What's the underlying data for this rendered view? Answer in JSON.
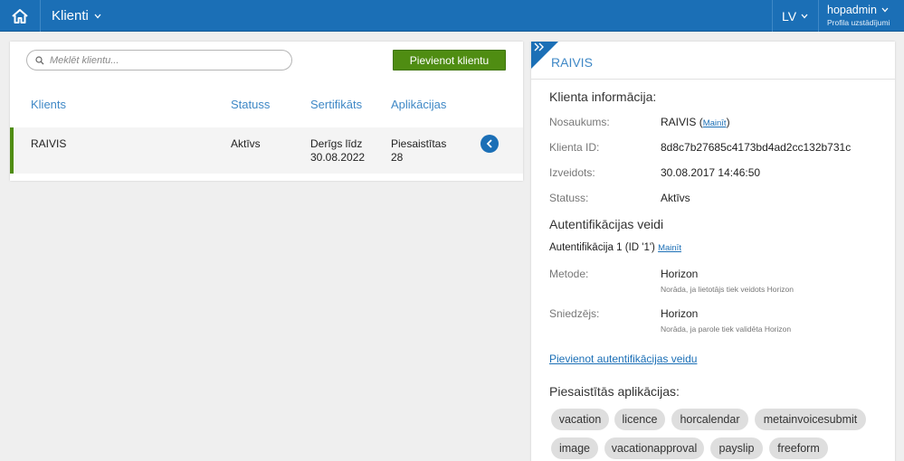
{
  "topbar": {
    "section": "Klienti",
    "language": "LV",
    "username": "hopadmin",
    "user_settings": "Profila uzstādījumi"
  },
  "clients": {
    "search_placeholder": "Meklēt klientu...",
    "add_button": "Pievienot klientu",
    "columns": [
      "Klients",
      "Statuss",
      "Sertifikāts",
      "Aplikācijas"
    ],
    "rows": [
      {
        "name": "RAIVIS",
        "status": "Aktīvs",
        "cert_line1": "Derīgs līdz",
        "cert_line2": "30.08.2022",
        "apps_line1": "Piesaistītas",
        "apps_line2": "28"
      }
    ]
  },
  "detail": {
    "title": "RAIVIS",
    "info_title": "Klienta informācija:",
    "fields": [
      {
        "label": "Nosaukums:",
        "value": "RAIVIS",
        "action": "Mainīt"
      },
      {
        "label": "Klienta ID:",
        "value": "8d8c7b27685c4173bd4ad2cc132b731c"
      },
      {
        "label": "Izveidots:",
        "value": "30.08.2017 14:46:50"
      },
      {
        "label": "Statuss:",
        "value": "Aktīvs"
      }
    ],
    "auth_title": "Autentifikācijas veidi",
    "auth": {
      "name": "Autentifikācija 1 (ID '1')",
      "action": "Mainīt",
      "method_label": "Metode:",
      "method_value": "Horizon",
      "method_note": "Norāda, ja lietotājs tiek veidots Horizon",
      "provider_label": "Sniedzējs:",
      "provider_value": "Horizon",
      "provider_note": "Norāda, ja parole tiek validēta Horizon"
    },
    "add_auth": "Pievienot autentifikācijas veidu",
    "apps_title": "Piesaistītās aplikācijas:",
    "apps": [
      "vacation",
      "licence",
      "horcalendar",
      "metainvoicesubmit",
      "image",
      "vacationapproval",
      "payslip",
      "freeform"
    ]
  },
  "colors": {
    "topbar": "#1b6fb6",
    "accent_green": "#4f8d12",
    "link": "#1b6fb6"
  }
}
